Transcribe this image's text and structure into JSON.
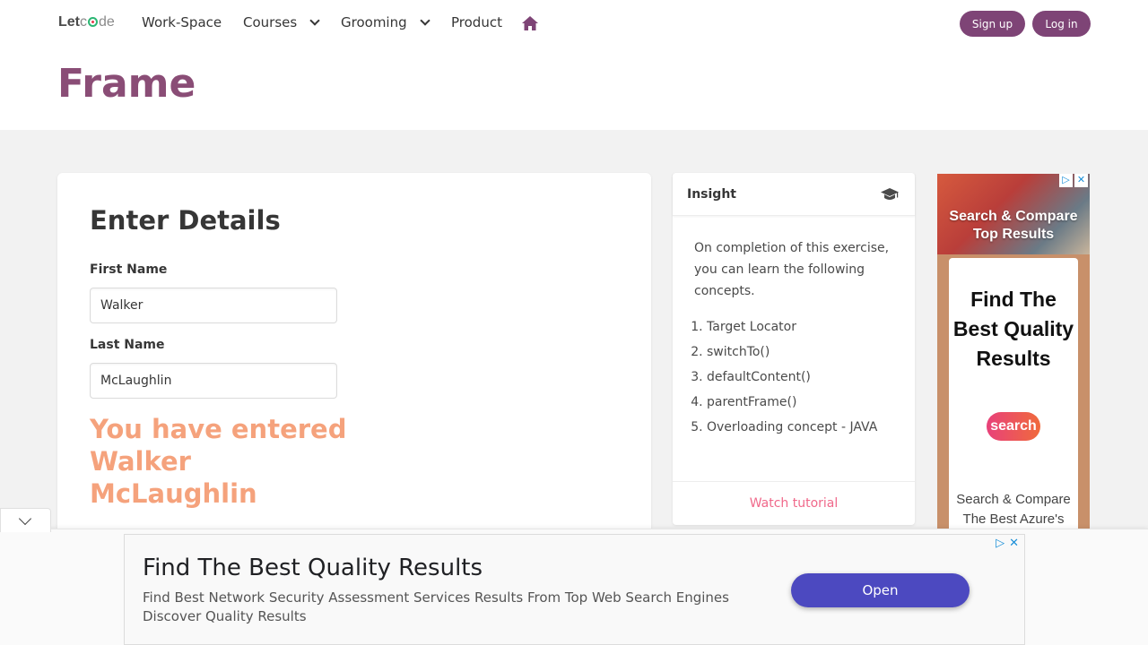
{
  "nav": {
    "logo_let": "Let",
    "logo_c": "c",
    "logo_rest": "de",
    "items": [
      {
        "label": "Work-Space"
      },
      {
        "label": "Courses"
      },
      {
        "label": "Grooming"
      },
      {
        "label": "Product"
      }
    ],
    "signup": "Sign up",
    "login": "Log in",
    "home_icon": "home-icon"
  },
  "hero": {
    "title": "Frame"
  },
  "form": {
    "title": "Enter Details",
    "first_name_label": "First Name",
    "first_name_value": "Walker",
    "last_name_label": "Last Name",
    "last_name_value": "McLaughlin",
    "entered_line1": "You have entered",
    "entered_line2": "Walker",
    "entered_line3": "McLaughlin"
  },
  "insight": {
    "title": "Insight",
    "icon": "graduation-cap-icon",
    "description": "On completion of this exercise, you can learn the following concepts.",
    "items": [
      "Target Locator",
      "switchTo()",
      "defaultContent()",
      "parentFrame()",
      "Overloading concept - JAVA"
    ],
    "footer_link": "Watch tutorial"
  },
  "side_ad": {
    "headline": "Search & Compare Top Results",
    "big": "Find The Best Quality Results",
    "logo": "search",
    "small": "Search & Compare The Best Azure's Data Migration"
  },
  "bottom_ad": {
    "title": "Find The Best Quality Results",
    "description": "Find Best Network Security Assessment Services Results From Top Web Search Engines Discover Quality Results",
    "cta": "Open"
  },
  "colors": {
    "brand": "#7e4476",
    "title": "#8a4d76",
    "entered": "#f5a27c",
    "link": "#f0688a",
    "cta": "#4c49c0"
  }
}
